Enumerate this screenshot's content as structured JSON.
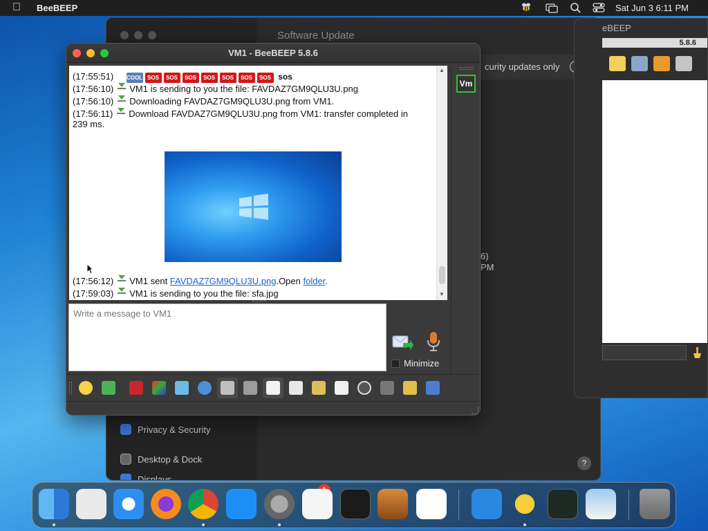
{
  "menubar": {
    "app_name": "BeeBEEP",
    "clock": "Sat Jun 3  6:11 PM",
    "icons": [
      "apple-icon",
      "beebeep-status-icon",
      "screen-mirroring-icon",
      "search-icon",
      "control-center-icon"
    ]
  },
  "settings": {
    "title": "Software Update",
    "security_updates": "curity updates only",
    "version_line1": "6)",
    "version_line2": "PM",
    "sidebar": [
      {
        "label": "Privacy & Security",
        "icon": "hand-icon"
      },
      {
        "label": "Desktop & Dock",
        "icon": "dock-icon"
      },
      {
        "label": "Displays",
        "icon": "display-icon"
      }
    ],
    "help": "?"
  },
  "beebeep_back": {
    "title": "eBEEP",
    "version": "5.8.6"
  },
  "chat": {
    "window_title": "VM1 - BeeBEEP 5.8.6",
    "emoticon_label": "sos",
    "emoticon_cool": "COOL",
    "emoticon_sos": "SOS",
    "messages": [
      {
        "ts": "(17:55:51)"
      },
      {
        "ts": "(17:56:10)",
        "text": "VM1 is sending to you the file: FAVDAZ7GM9QLU3U.png"
      },
      {
        "ts": "(17:56:10)",
        "text": "Downloading FAVDAZ7GM9QLU3U.png from VM1."
      },
      {
        "ts": "(17:56:11)",
        "text": "Download FAVDAZ7GM9QLU3U.png from VM1: transfer completed in",
        "text2": "239 ms."
      },
      {
        "ts": "(17:56:12)",
        "text": "VM1 sent ",
        "link": "FAVDAZ7GM9QLU3U.png",
        "text_mid": ".Open ",
        "link2": "folder",
        "text_end": "."
      },
      {
        "ts": "(17:59:03)",
        "text": "VM1 is sending to you the file: sfa.jpg"
      }
    ],
    "user_badge": "Vm",
    "input_placeholder": "Write a message to VM1",
    "minimize_label": "Minimize",
    "toolbar": [
      "emoticons-icon",
      "send-file-icon",
      "font-icon",
      "font-color-icon",
      "filter-icon",
      "settings-icon",
      "spellcheck-icon",
      "dictionary-icon",
      "music-note-icon",
      "save-chat-icon",
      "export-icon",
      "clear-icon",
      "html-icon",
      "screenshot-icon",
      "folder-icon",
      "notes-icon",
      "detach-icon"
    ]
  },
  "dock": {
    "badge": "1",
    "apps": [
      "finder-icon",
      "launchpad-icon",
      "safari-icon",
      "firefox-icon",
      "chrome-icon",
      "app-store-icon",
      "system-settings-icon",
      "textedit-icon",
      "terminal-icon",
      "garageband-icon",
      "vscode-icon",
      "keynote-icon",
      "beebeep-icon",
      "activity-monitor-icon",
      "preview-icon",
      "trash-icon"
    ]
  }
}
